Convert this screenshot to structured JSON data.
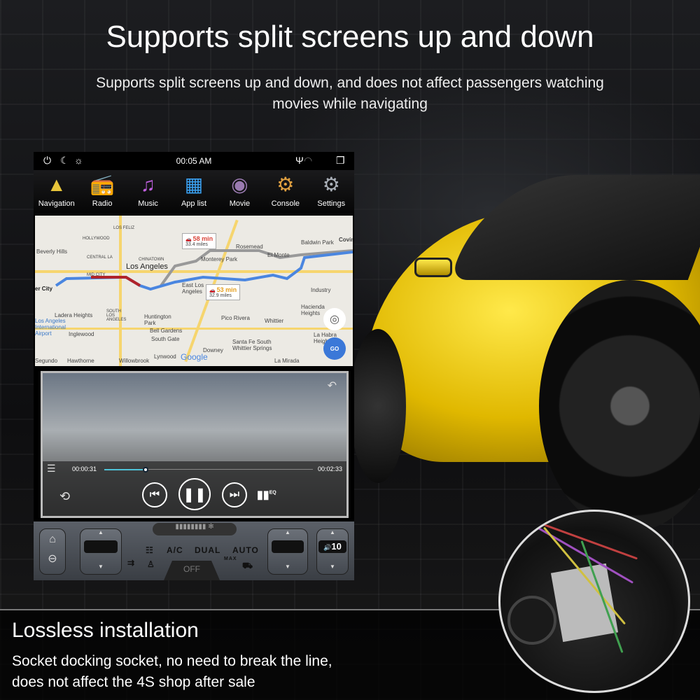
{
  "headline": "Supports split screens up and down",
  "subheadline": "Supports split screens up and down, and does not affect passengers watching movies while navigating",
  "device": {
    "status_bar": {
      "time": "00:05 AM",
      "left_icons": [
        "power-icon",
        "night-mode-icon",
        "brightness-icon"
      ],
      "right_icons": [
        "usb-icon",
        "wifi-icon",
        "multi-window-icon"
      ]
    },
    "apps": [
      {
        "label": "Navigation",
        "icon": "navigation-icon",
        "glyph": "▲",
        "color": "#e8c53a"
      },
      {
        "label": "Radio",
        "icon": "radio-icon",
        "glyph": "📻",
        "color": "#d23a52"
      },
      {
        "label": "Music",
        "icon": "music-icon",
        "glyph": "♫",
        "color": "#c060e0"
      },
      {
        "label": "App list",
        "icon": "app-list-icon",
        "glyph": "▦",
        "color": "#3aa0f0"
      },
      {
        "label": "Movie",
        "icon": "movie-reel-icon",
        "glyph": "◉",
        "color": "#9a7ab0"
      },
      {
        "label": "Console",
        "icon": "console-seat-icon",
        "glyph": "⚙",
        "color": "#e0a040"
      },
      {
        "label": "Settings",
        "icon": "settings-gear-icon",
        "glyph": "⚙",
        "color": "#aab0b8"
      }
    ],
    "map": {
      "labels": [
        "Los Angeles",
        "Beverly Hills",
        "Monterey Park",
        "Rosemead",
        "El Monte",
        "Baldwin Park",
        "Covin",
        "East Los Angeles",
        "Industry",
        "Hacienda Heights",
        "Huntington Park",
        "Pico Rivera",
        "Whittier",
        "Ladera Heights",
        "Los Angeles International Airport",
        "Inglewood",
        "South Gate",
        "Bell Gardens",
        "Downey",
        "Santa Fe South Whittier Springs",
        "Lynwood",
        "La Habra Heights",
        "Hawthorne",
        "Willowbrook",
        "La Mirada",
        "Segundo",
        "er City",
        "HOLLYWOOD",
        "LOS FELIZ",
        "CENTRAL LA",
        "MID CITY",
        "CHINATOWN",
        "SOUTH LOS ANGELES"
      ],
      "route_alt": {
        "time": "58 min",
        "distance": "33.4 miles",
        "color": "#d9463b"
      },
      "route_main": {
        "time": "53 min",
        "distance": "32.9 miles",
        "color": "#e6a020"
      },
      "brand": "Google",
      "go_label": "GO"
    },
    "video": {
      "elapsed": "00:00:31",
      "duration": "00:02:33",
      "progress_fraction": 0.2,
      "eq_label": "EQ"
    },
    "climate": {
      "ac": "A/C",
      "dual": "DUAL",
      "auto": "AUTO",
      "off": "OFF",
      "max": "MAX",
      "volume": "10"
    }
  },
  "bottom": {
    "title": "Lossless installation",
    "line1": "Socket docking socket, no need to break the line,",
    "line2": "does not affect the 4S shop after sale"
  }
}
